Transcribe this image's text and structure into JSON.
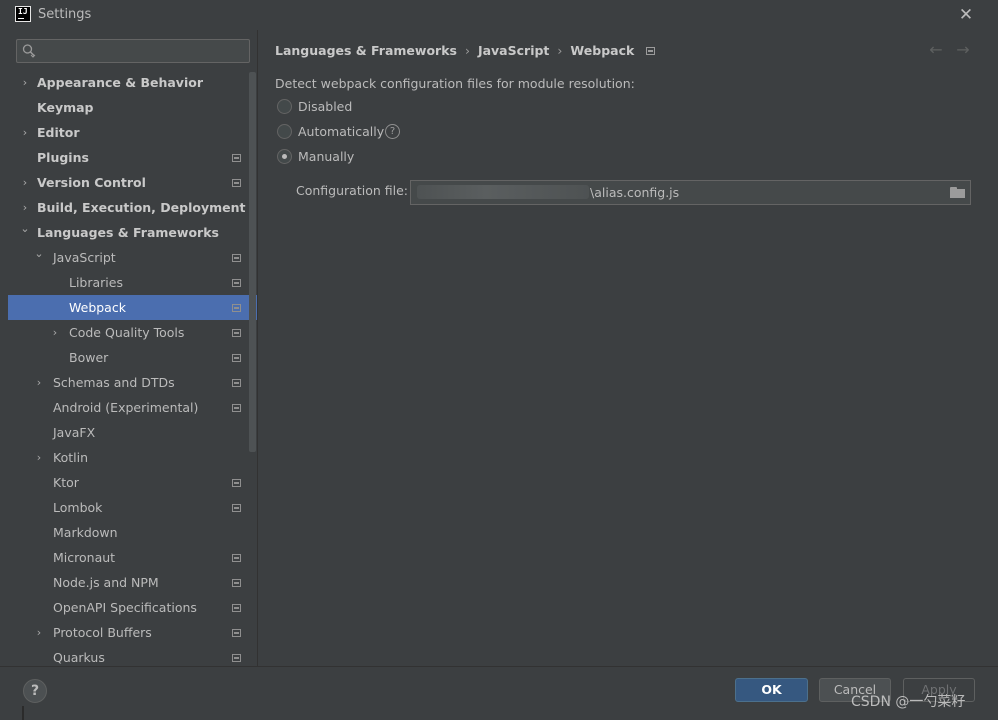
{
  "window": {
    "title": "Settings",
    "app_icon_text": "IJ",
    "close_symbol": "✕"
  },
  "sidebar": {
    "search": {
      "placeholder": "",
      "value": ""
    },
    "items": [
      {
        "label": "Appearance & Behavior",
        "arrow": "›",
        "bold": true,
        "indent": 0,
        "project": false
      },
      {
        "label": "Keymap",
        "arrow": "",
        "bold": true,
        "indent": 0,
        "project": false
      },
      {
        "label": "Editor",
        "arrow": "›",
        "bold": true,
        "indent": 0,
        "project": false
      },
      {
        "label": "Plugins",
        "arrow": "",
        "bold": true,
        "indent": 0,
        "project": true
      },
      {
        "label": "Version Control",
        "arrow": "›",
        "bold": true,
        "indent": 0,
        "project": true
      },
      {
        "label": "Build, Execution, Deployment",
        "arrow": "›",
        "bold": true,
        "indent": 0,
        "project": false
      },
      {
        "label": "Languages & Frameworks",
        "arrow": "⌄",
        "bold": true,
        "indent": 0,
        "project": false
      },
      {
        "label": "JavaScript",
        "arrow": "⌄",
        "bold": false,
        "indent": 1,
        "project": true
      },
      {
        "label": "Libraries",
        "arrow": "",
        "bold": false,
        "indent": 2,
        "project": true
      },
      {
        "label": "Webpack",
        "arrow": "",
        "bold": false,
        "indent": 2,
        "project": true,
        "selected": true
      },
      {
        "label": "Code Quality Tools",
        "arrow": "›",
        "bold": false,
        "indent": 2,
        "project": true
      },
      {
        "label": "Bower",
        "arrow": "",
        "bold": false,
        "indent": 2,
        "project": true
      },
      {
        "label": "Schemas and DTDs",
        "arrow": "›",
        "bold": false,
        "indent": 1,
        "project": true
      },
      {
        "label": "Android (Experimental)",
        "arrow": "",
        "bold": false,
        "indent": 1,
        "project": true
      },
      {
        "label": "JavaFX",
        "arrow": "",
        "bold": false,
        "indent": 1,
        "project": false
      },
      {
        "label": "Kotlin",
        "arrow": "›",
        "bold": false,
        "indent": 1,
        "project": false
      },
      {
        "label": "Ktor",
        "arrow": "",
        "bold": false,
        "indent": 1,
        "project": true
      },
      {
        "label": "Lombok",
        "arrow": "",
        "bold": false,
        "indent": 1,
        "project": true
      },
      {
        "label": "Markdown",
        "arrow": "",
        "bold": false,
        "indent": 1,
        "project": false
      },
      {
        "label": "Micronaut",
        "arrow": "",
        "bold": false,
        "indent": 1,
        "project": true
      },
      {
        "label": "Node.js and NPM",
        "arrow": "",
        "bold": false,
        "indent": 1,
        "project": true
      },
      {
        "label": "OpenAPI Specifications",
        "arrow": "",
        "bold": false,
        "indent": 1,
        "project": true
      },
      {
        "label": "Protocol Buffers",
        "arrow": "›",
        "bold": false,
        "indent": 1,
        "project": true
      },
      {
        "label": "Quarkus",
        "arrow": "",
        "bold": false,
        "indent": 1,
        "project": true
      }
    ]
  },
  "main": {
    "breadcrumb": [
      "Languages & Frameworks",
      "JavaScript",
      "Webpack"
    ],
    "breadcrumb_separator": "›",
    "nav_back": "←",
    "nav_forward": "→",
    "description": "Detect webpack configuration files for module resolution:",
    "options": [
      {
        "label": "Disabled",
        "checked": false,
        "help": false
      },
      {
        "label": "Automatically",
        "checked": false,
        "help": true
      },
      {
        "label": "Manually",
        "checked": true,
        "help": false
      }
    ],
    "help_symbol": "?",
    "config": {
      "label": "Configuration file:",
      "value": "\\alias.config.js"
    }
  },
  "footer": {
    "help_symbol": "?",
    "ok_label": "OK",
    "cancel_label": "Cancel",
    "apply_label": "Apply",
    "watermark": "CSDN @一勺菜籽"
  },
  "colors": {
    "background": "#3c3f41",
    "selection": "#4b6eaf",
    "ok_button": "#365880",
    "text": "#bbbbbb"
  }
}
